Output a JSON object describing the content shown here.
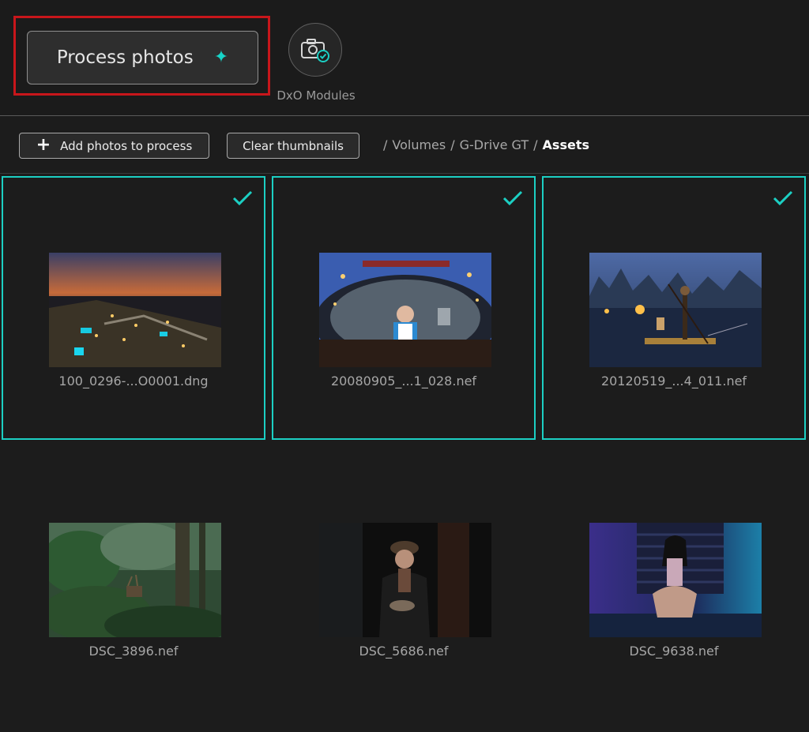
{
  "header": {
    "process_button_label": "Process photos",
    "modules_label": "DxO Modules"
  },
  "toolbar": {
    "add_photos_label": "Add photos to process",
    "clear_thumbnails_label": "Clear thumbnails",
    "breadcrumb": [
      "Volumes",
      "G-Drive GT",
      "Assets"
    ]
  },
  "photos": [
    {
      "filename": "100_0296-...O0001.dng",
      "selected": true
    },
    {
      "filename": "20080905_...1_028.nef",
      "selected": true
    },
    {
      "filename": "20120519_...4_011.nef",
      "selected": true
    },
    {
      "filename": "DSC_3896.nef",
      "selected": false
    },
    {
      "filename": "DSC_5686.nef",
      "selected": false
    },
    {
      "filename": "DSC_9638.nef",
      "selected": false
    }
  ],
  "colors": {
    "accent": "#1ccfc3",
    "highlight": "#c8161b",
    "background": "#1c1c1c"
  },
  "icons": {
    "sparkle": "sparkle-icon",
    "modules": "camera-check-icon",
    "add": "plus-icon",
    "selected": "checkmark-icon"
  }
}
